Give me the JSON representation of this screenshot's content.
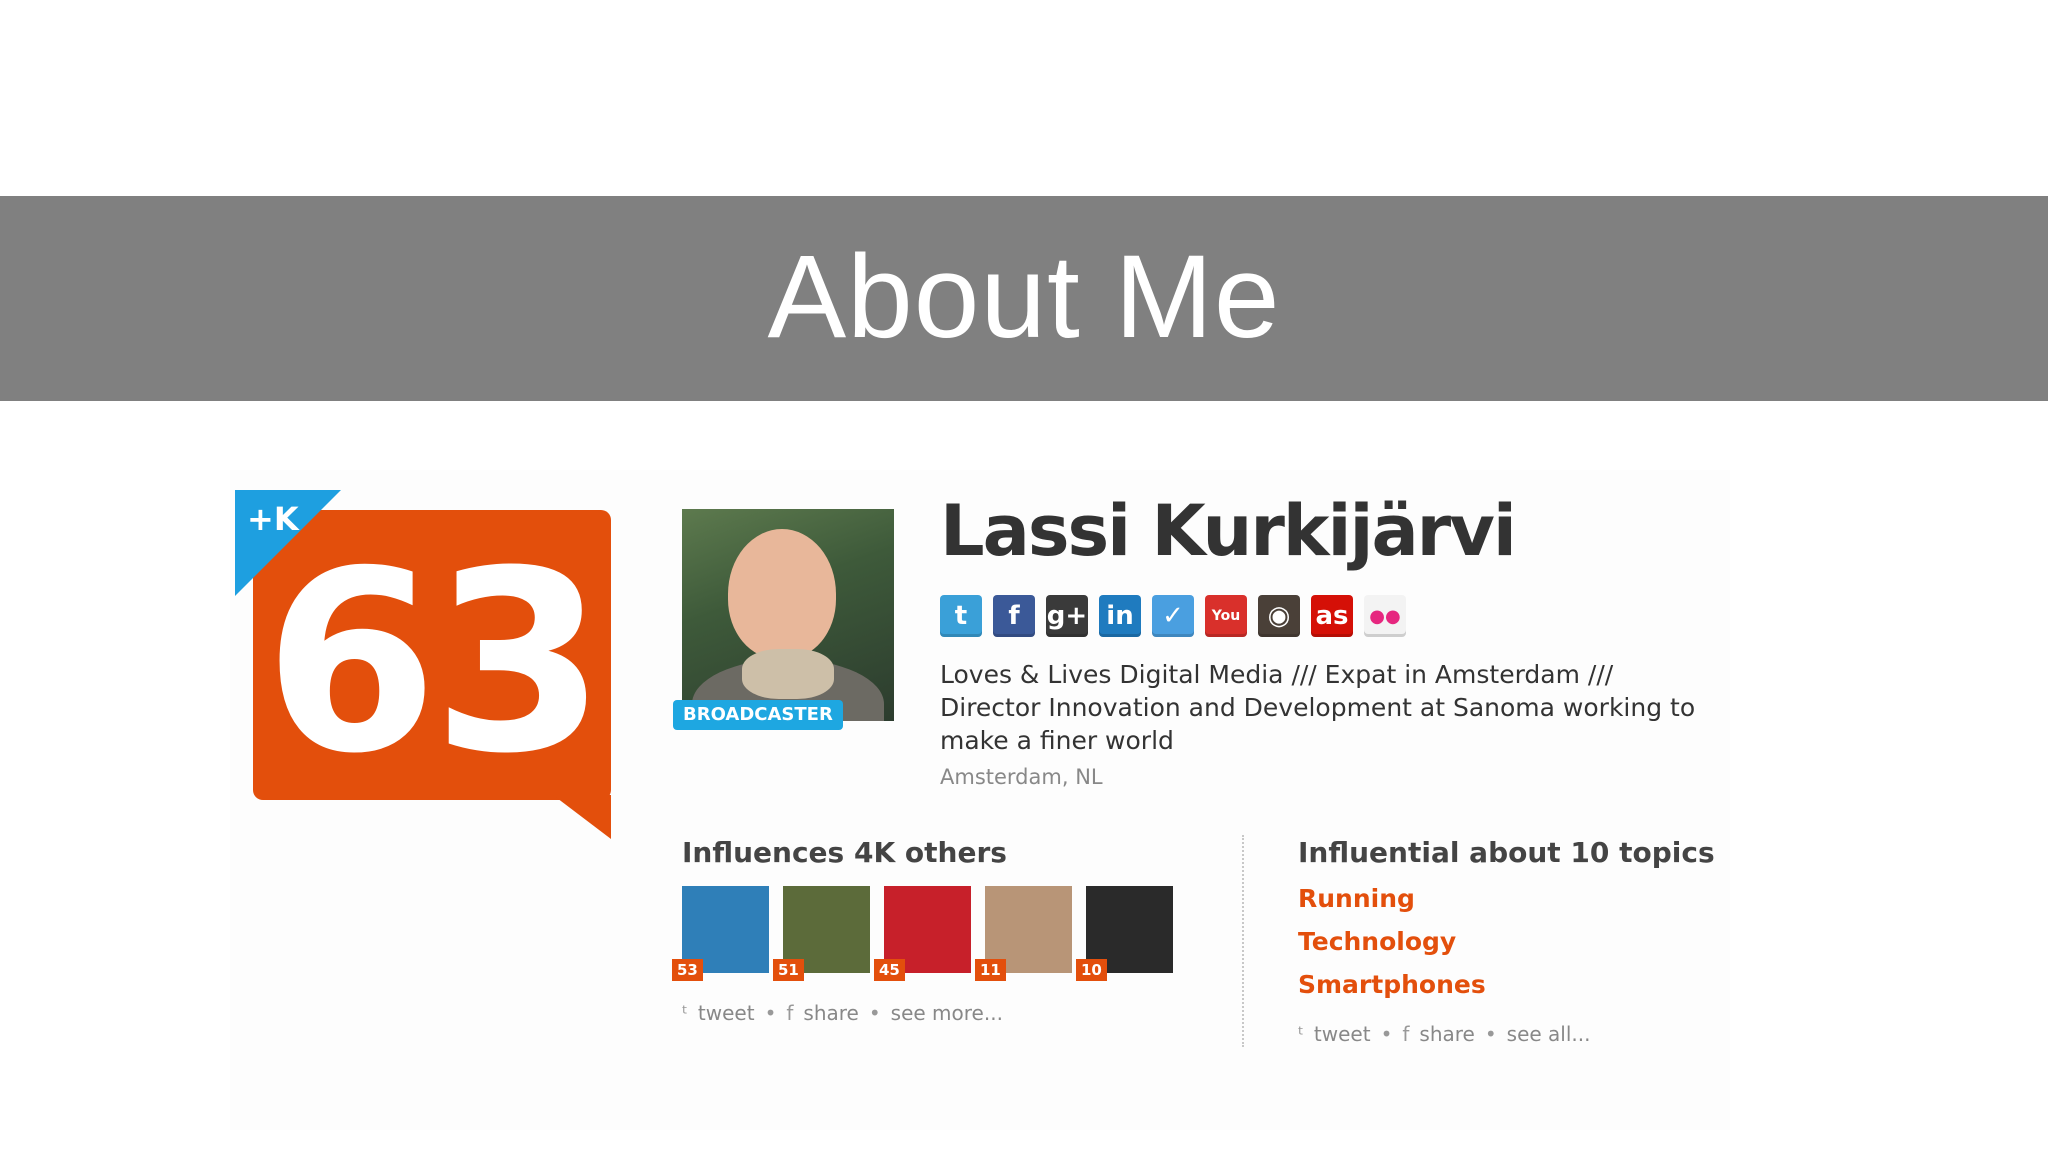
{
  "slide": {
    "title": "About Me"
  },
  "score": {
    "value": "63",
    "plus_label": "+K"
  },
  "profile": {
    "name": "Lassi Kurkijärvi",
    "role_badge": "BROADCASTER",
    "bio": "Loves & Lives Digital Media /// Expat in Amsterdam /// Director Innovation and Development at Sanoma working to make a finer world",
    "location": "Amsterdam, NL",
    "networks": [
      {
        "icon": "twitter-icon",
        "glyph": "t",
        "color": "#3aa0d8"
      },
      {
        "icon": "facebook-icon",
        "glyph": "f",
        "color": "#3b5998"
      },
      {
        "icon": "google-plus-icon",
        "glyph": "g+",
        "color": "#3a3a3a"
      },
      {
        "icon": "linkedin-icon",
        "glyph": "in",
        "color": "#1f7bbf"
      },
      {
        "icon": "foursquare-icon",
        "glyph": "✓",
        "color": "#4a9fe0"
      },
      {
        "icon": "youtube-icon",
        "glyph": "You",
        "color": "#d9302b"
      },
      {
        "icon": "instagram-icon",
        "glyph": "◉",
        "color": "#4a4038"
      },
      {
        "icon": "lastfm-icon",
        "glyph": "as",
        "color": "#d51007"
      },
      {
        "icon": "flickr-icon",
        "glyph": "●●",
        "color": "#f3f3f3"
      }
    ]
  },
  "influences": {
    "title": "Influences 4K others",
    "people": [
      {
        "score": "53",
        "color": "#2f7fb8"
      },
      {
        "score": "51",
        "color": "#5c6b3a"
      },
      {
        "score": "45",
        "color": "#c7202a"
      },
      {
        "score": "11",
        "color": "#b89577"
      },
      {
        "score": "10",
        "color": "#2a2a2a"
      }
    ],
    "actions": {
      "tweet": "tweet",
      "share": "share",
      "more": "see more..."
    }
  },
  "topics": {
    "title": "Influential about 10 topics",
    "items": [
      "Running",
      "Technology",
      "Smartphones"
    ],
    "actions": {
      "tweet": "tweet",
      "share": "share",
      "more": "see all..."
    }
  }
}
